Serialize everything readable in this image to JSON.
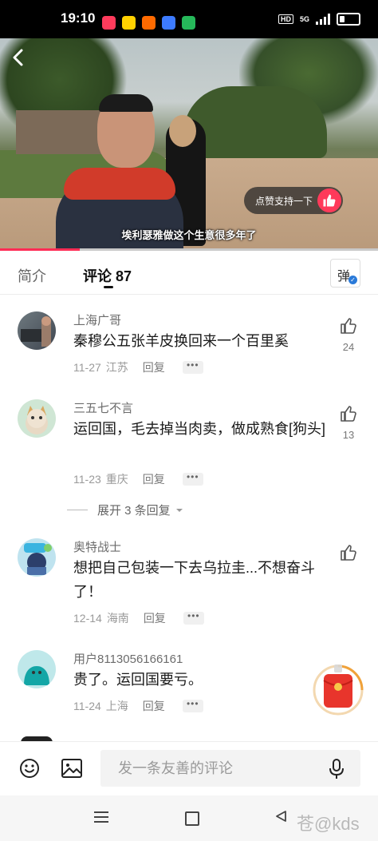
{
  "status_bar": {
    "time": "19:10",
    "hd_label": "HD",
    "network_label": "5G",
    "app_icon_colors": [
      "#ff3b5c",
      "#ffd100",
      "#ff6a00",
      "#3d7bff",
      "#26b85a"
    ]
  },
  "video": {
    "like_support_label": "点赞支持一下",
    "subtitle": "埃利瑟雅做这个生意很多年了",
    "progress_fraction": 0.21,
    "icons": {
      "back": "back-arrow-icon",
      "like": "thumbs-up-icon"
    }
  },
  "tabs": {
    "intro_label": "简介",
    "comments_label": "评论 87",
    "danmu_label": "弹"
  },
  "comments": [
    {
      "name": "上海广哥",
      "text": "秦穆公五张羊皮换回来一个百里奚",
      "date": "11-27",
      "location": "江苏",
      "reply_label": "回复",
      "likes": "24"
    },
    {
      "name": "三五七不言",
      "text": "运回国，毛去掉当肉卖，做成熟食[狗头]",
      "date": "11-23",
      "location": "重庆",
      "reply_label": "回复",
      "likes": "13"
    },
    {
      "name": "奥特战士",
      "text": "想把自己包装一下去乌拉圭...不想奋斗了！",
      "date": "12-14",
      "location": "海南",
      "reply_label": "回复",
      "likes": ""
    },
    {
      "name": "用户8113056166161",
      "text": "贵了。运回国要亏。",
      "date": "11-24",
      "location": "上海",
      "reply_label": "回复",
      "likes": ""
    }
  ],
  "expand_replies_label": "展开 3 条回复",
  "more_label": "•••",
  "bottom_bar": {
    "input_placeholder": "发一条友善的评论",
    "icons": {
      "emoji": "emoji-icon",
      "image": "image-icon",
      "mic": "microphone-icon"
    }
  },
  "nav_bar": {
    "watermark": "苍@kds"
  },
  "colors": {
    "accent_red": "#ff2c55",
    "verified_blue": "#2a7ad9"
  }
}
